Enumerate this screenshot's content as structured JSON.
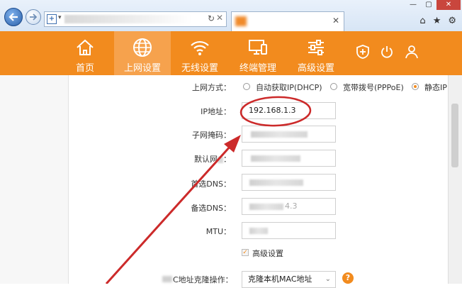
{
  "browser": {
    "favicon_letter": "+",
    "address_dropdown": "▾",
    "refresh_icon": "↻",
    "close_icon": "✕",
    "tab_close_icon": "✕",
    "right_icons": [
      "⌂",
      "★",
      "⚙"
    ],
    "window_buttons": [
      "—",
      "▢",
      "✕"
    ]
  },
  "nav": {
    "items": [
      {
        "label": "首页",
        "icon": "home-icon"
      },
      {
        "label": "上网设置",
        "icon": "globe-icon",
        "active": true
      },
      {
        "label": "无线设置",
        "icon": "wifi-icon"
      },
      {
        "label": "终端管理",
        "icon": "devices-icon"
      },
      {
        "label": "高级设置",
        "icon": "sliders-icon"
      }
    ],
    "utility_icons": [
      "shield-icon",
      "power-icon",
      "user-icon"
    ],
    "accent_color": "#f28b1e"
  },
  "form": {
    "connection_type_label": "上网方式：",
    "options": [
      {
        "label": "自动获取IP(DHCP)",
        "checked": false
      },
      {
        "label": "宽带拨号(PPPoE)",
        "checked": false
      },
      {
        "label": "静态IP",
        "checked": true
      }
    ],
    "ip_label": "IP地址：",
    "ip_value": "192.168.1.3",
    "subnet_label": "子网掩码：",
    "gateway_label": "默认网",
    "gateway_suffix": "：",
    "dns1_label": "首选DNS：",
    "dns2_label": "备选DNS：",
    "dns2_partial": "4.3",
    "mtu_label": "MTU：",
    "advanced_label": "高级设置",
    "advanced_checked": true,
    "mac_label": "C地址克隆操作：",
    "mac_select_value": "克隆本机MAC地址",
    "help_icon": "?"
  }
}
